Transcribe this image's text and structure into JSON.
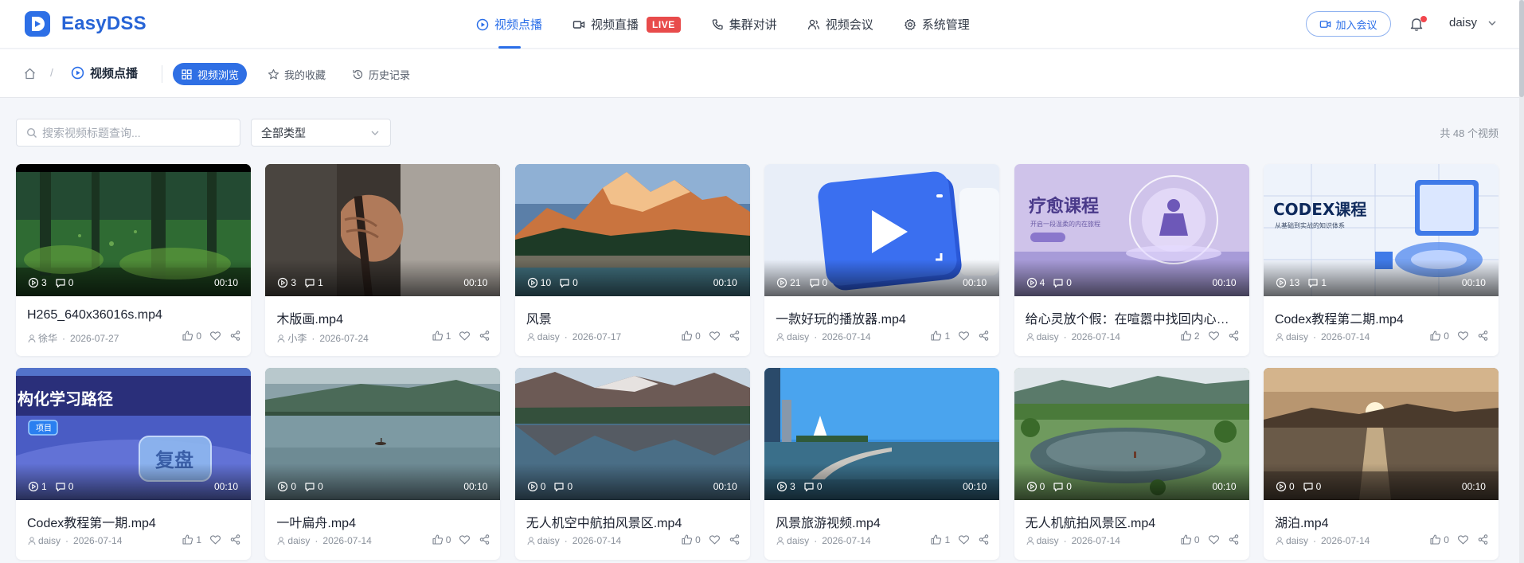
{
  "header": {
    "brand": "EasyDSS",
    "nav": [
      {
        "label": "视频点播",
        "icon": "play-circle-icon",
        "active": true
      },
      {
        "label": "视频直播",
        "icon": "video-camera-icon",
        "badge": "LIVE"
      },
      {
        "label": "集群对讲",
        "icon": "phone-icon"
      },
      {
        "label": "视频会议",
        "icon": "users-icon"
      },
      {
        "label": "系统管理",
        "icon": "gear-icon"
      }
    ],
    "join_meeting": "加入会议",
    "username": "daisy",
    "accent": "#2a6ee8",
    "live_color": "#e84b4b"
  },
  "subnav": {
    "breadcrumb_sep": "/",
    "current": "视频点播",
    "tabs": [
      {
        "label": "视频浏览",
        "icon": "grid-icon",
        "active": true
      },
      {
        "label": "我的收藏",
        "icon": "star-icon"
      },
      {
        "label": "历史记录",
        "icon": "history-icon"
      }
    ]
  },
  "filters": {
    "search_placeholder": "搜索视频标题查询...",
    "type_select": "全部类型",
    "total": "共 48 个视频"
  },
  "videos": [
    {
      "title": "H265_640x36016s.mp4",
      "plays": "3",
      "comments": "0",
      "duration": "00:10",
      "author": "徐华",
      "date": "2026-07-27",
      "likes": "0",
      "thumb": "forest"
    },
    {
      "title": "木版画.mp4",
      "plays": "3",
      "comments": "1",
      "duration": "00:10",
      "author": "小李",
      "date": "2026-07-24",
      "likes": "1",
      "thumb": "hand"
    },
    {
      "title": "风景",
      "plays": "10",
      "comments": "0",
      "duration": "00:10",
      "author": "daisy",
      "date": "2026-07-17",
      "likes": "0",
      "thumb": "mountain"
    },
    {
      "title": "一款好玩的播放器.mp4",
      "plays": "21",
      "comments": "0",
      "duration": "00:10",
      "author": "daisy",
      "date": "2026-07-14",
      "likes": "1",
      "thumb": "player"
    },
    {
      "title": "给心灵放个假：在喧嚣中找回内心的宁静",
      "plays": "4",
      "comments": "0",
      "duration": "00:10",
      "author": "daisy",
      "date": "2026-07-14",
      "likes": "2",
      "thumb": "meditation",
      "thumb_text": "疗愈课程",
      "thumb_subtext": "开启一段温柔的内在旅程"
    },
    {
      "title": "Codex教程第二期.mp4",
      "plays": "13",
      "comments": "1",
      "duration": "00:10",
      "author": "daisy",
      "date": "2026-07-14",
      "likes": "0",
      "thumb": "codex2",
      "thumb_text": "CODEX课程",
      "thumb_subtext": "从基础到实战的知识体系"
    },
    {
      "title": "Codex教程第一期.mp4",
      "plays": "1",
      "comments": "0",
      "duration": "00:10",
      "author": "daisy",
      "date": "2026-07-14",
      "likes": "1",
      "thumb": "codex1",
      "thumb_text": "构化学习路径",
      "thumb_tag": "项目",
      "thumb_button": "复盘"
    },
    {
      "title": "一叶扁舟.mp4",
      "plays": "0",
      "comments": "0",
      "duration": "00:10",
      "author": "daisy",
      "date": "2026-07-14",
      "likes": "0",
      "thumb": "lake-boat"
    },
    {
      "title": "无人机空中航拍风景区.mp4",
      "plays": "0",
      "comments": "0",
      "duration": "00:10",
      "author": "daisy",
      "date": "2026-07-14",
      "likes": "0",
      "thumb": "reflection"
    },
    {
      "title": "风景旅游视频.mp4",
      "plays": "3",
      "comments": "0",
      "duration": "00:10",
      "author": "daisy",
      "date": "2026-07-14",
      "likes": "1",
      "thumb": "coast"
    },
    {
      "title": "无人机航拍风景区.mp4",
      "plays": "0",
      "comments": "0",
      "duration": "00:10",
      "author": "daisy",
      "date": "2026-07-14",
      "likes": "0",
      "thumb": "pond"
    },
    {
      "title": "湖泊.mp4",
      "plays": "0",
      "comments": "0",
      "duration": "00:10",
      "author": "daisy",
      "date": "2026-07-14",
      "likes": "0",
      "thumb": "sunset"
    }
  ]
}
